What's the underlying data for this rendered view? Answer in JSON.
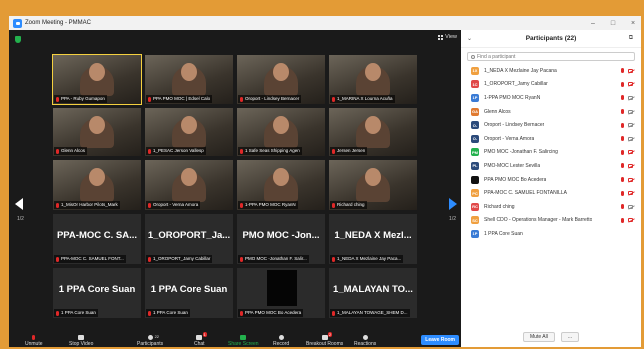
{
  "window": {
    "title": "Zoom Meeting - PMMAC"
  },
  "controls": {
    "minimize": "–",
    "maximize": "□",
    "close": "×"
  },
  "view_label": "View",
  "pages": {
    "left": "1/2",
    "right": "1/2"
  },
  "tiles": [
    {
      "name": "PPA - Ruby Gumapon",
      "kind": "video",
      "active": true
    },
    {
      "name": "PPA PMO MOC | Edsel Calo",
      "kind": "video"
    },
    {
      "name": "Oroport - Lindsey Bernacer",
      "kind": "video"
    },
    {
      "name": "1_MARINA X Lourna Acuña",
      "kind": "video"
    },
    {
      "name": "Glenn Alcos",
      "kind": "video"
    },
    {
      "name": "1_PESAC Jerson Vallesp",
      "kind": "video"
    },
    {
      "name": "1 Safe Seas Shipping Agen",
      "kind": "video"
    },
    {
      "name": "Jersen Jersen",
      "kind": "video"
    },
    {
      "name": "1_MisOr Harbor Pilots_Mark",
      "kind": "video"
    },
    {
      "name": "Oroport - Verna Amora",
      "kind": "video"
    },
    {
      "name": "1-PPA PMO MOC RyanN",
      "kind": "video"
    },
    {
      "name": "Richard ching",
      "kind": "video"
    },
    {
      "name": "PPA-MOC C. SAMUEL FONT...",
      "kind": "name",
      "big": "PPA-MOC C. SA..."
    },
    {
      "name": "1_OROPORT_Jamy Cabillar",
      "kind": "name",
      "big": "1_OROPORT_Ja..."
    },
    {
      "name": "PMO MOC -Jonathan F. Salir...",
      "kind": "name",
      "big": "PMO MOC -Jon..."
    },
    {
      "name": "1_NEDA X Mezlaine Jay Paca...",
      "kind": "name",
      "big": "1_NEDA X Mezl..."
    },
    {
      "name": "1 PPA Core Suan",
      "kind": "name",
      "big": "1 PPA Core Suan"
    },
    {
      "name": "1 PPA Core Suan",
      "kind": "name",
      "big": "1 PPA Core Suan"
    },
    {
      "name": "PPA PMO MOC Bo Acedera",
      "kind": "dark",
      "big": ""
    },
    {
      "name": "1_MALAYAN TOWAGE_SHEM D...",
      "kind": "name",
      "big": "1_MALAYAN TO..."
    }
  ],
  "toolbar": {
    "unmute": "Unmute",
    "stop_video": "Stop Video",
    "participants": "Participants",
    "participants_count": "22",
    "chat": "Chat",
    "chat_badge": "1",
    "share_screen": "Share Screen",
    "record": "Record",
    "breakout_rooms": "Breakout Rooms",
    "breakout_badge": "2",
    "reactions": "Reactions",
    "leave": "Leave Room"
  },
  "panel": {
    "title": "Participants (22)",
    "search_placeholder": "Find a participant",
    "participants": [
      {
        "initials": "1X",
        "color": "#f0a040",
        "name": "1_NEDA X Mezlaine Jay Pacana",
        "cam": "red"
      },
      {
        "initials": "1C",
        "color": "#e04848",
        "name": "1_OROPORT_Jamy Cabillar",
        "cam": "red"
      },
      {
        "initials": "1P",
        "color": "#3a7bd5",
        "name": "1-PPA PMO MOC RyanN",
        "cam": "on"
      },
      {
        "initials": "GA",
        "color": "#e07a30",
        "name": "Glenn Alcos",
        "cam": "on"
      },
      {
        "initials": "O-",
        "color": "#2b4a7a",
        "name": "Oroport - Lindsey Bernacer",
        "cam": "on"
      },
      {
        "initials": "O-",
        "color": "#2b4a7a",
        "name": "Oroport - Verna Amora",
        "cam": "on"
      },
      {
        "initials": "PM",
        "color": "#23b14d",
        "name": "PMO MOC -Jonathan F. Salircing",
        "cam": "red"
      },
      {
        "initials": "PL",
        "color": "#2b4a7a",
        "name": "PMO-MOC Lester Sevilla",
        "cam": "red"
      },
      {
        "initials": "",
        "color": "#111111",
        "name": "PPA PMO MOC Bo Acedera",
        "cam": "red"
      },
      {
        "initials": "PC",
        "color": "#f0a040",
        "name": "PPA-MOC C. SAMUEL FONTANILLA",
        "cam": "red"
      },
      {
        "initials": "RC",
        "color": "#e04848",
        "name": "Richard ching",
        "cam": "on"
      },
      {
        "initials": "SC",
        "color": "#f0a040",
        "name": "Shell CDO - Operations Manager - Mark Barretto",
        "cam": "red"
      },
      {
        "initials": "1P",
        "color": "#3a7bd5",
        "name": "1 PPA Core Suan",
        "cam": "none"
      }
    ],
    "mute_all": "Mute All",
    "more": "..."
  }
}
